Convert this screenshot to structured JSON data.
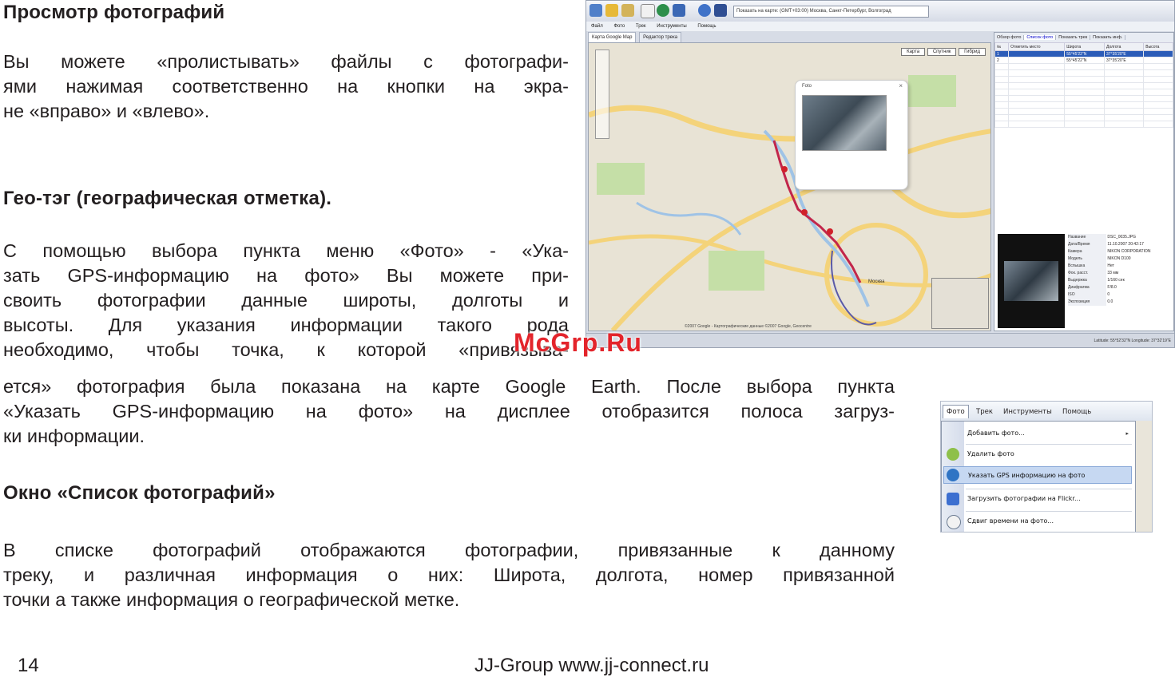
{
  "sections": [
    {
      "heading": "Просмотр фотографий",
      "lines": [
        "Вы можете «пролистывать» файлы с фотографи-",
        "ями нажимая соответственно на кнопки на экра-",
        "не «вправо» и «влево»."
      ]
    },
    {
      "heading": "Гео-тэг (географическая отметка).",
      "lines": [
        "С помощью выбора пункта меню «Фото» - «Ука-",
        "зать GPS-информацию на фото» Вы можете при-",
        "своить фотографии данные широты, долготы и",
        "высоты. Для указания информации такого рода",
        "необходимо, чтобы точка, к которой «привязыва-",
        "ется» фотография была показана на карте Google Earth. После выбора пункта",
        "«Указать GPS-информацию на фото» на дисплее отобразится полоса загруз-",
        "ки информации."
      ]
    },
    {
      "heading": "Окно «Список фотографий»",
      "lines": [
        "В списке фотографий отображаются фотографии, привязанные к данному",
        "треку, и различная информация о них:  Широта, долгота, номер привязанной",
        "точки а также информация о географической метке."
      ]
    }
  ],
  "footer": {
    "page_number": "14",
    "publisher": "JJ-Group www.jj-connect.ru"
  },
  "watermark": "McGrp.Ru",
  "app_screenshot": {
    "location_combo": "Показать на карте: (GMT+03:00) Москва, Санкт-Петербург, Волгоград",
    "menubar": [
      "Файл",
      "Фото",
      "Трек",
      "Инструменты",
      "Помощь"
    ],
    "map_tabs": [
      "Карта Google Map",
      "Редактор трека"
    ],
    "map_buttons": [
      "Карта",
      "Спутник",
      "Гибрид"
    ],
    "popup_title": "Foto",
    "map_city_label": "Москва",
    "map_copyright": "©2007 Google - Картографические данные ©2007 Google, Geocentre",
    "right_tabs": [
      "Обзор фото",
      "Список фото",
      "Показать трек",
      "Показать инф."
    ],
    "table_headers": [
      "№",
      "Отметить место",
      "Широта",
      "Долгота",
      "Высота"
    ],
    "table_rows": [
      [
        "1",
        "",
        "55°45'22\"N",
        "37°35'20\"E",
        ""
      ],
      [
        "2",
        "",
        "55°45'22\"N",
        "37°35'20\"E",
        ""
      ]
    ],
    "properties": [
      [
        "Название",
        "DSC_0035.JPG"
      ],
      [
        "Дата/Время",
        "11.10.2007 20:42:17"
      ],
      [
        "Камера",
        "NIKON CORPORATION"
      ],
      [
        "Модель",
        "NIKON D100"
      ],
      [
        "Вспышка",
        "Нет"
      ],
      [
        "Фок. расст.",
        "33 мм"
      ],
      [
        "Выдержка",
        "1/160 сек"
      ],
      [
        "Диафрагма",
        "F/8.0"
      ],
      [
        "ISO",
        "0"
      ],
      [
        "Экспозиция",
        "0.0"
      ]
    ],
    "status": "Latitude: 55°52'32\"N  Longitude: 37°32'19\"E"
  },
  "menu_screenshot": {
    "menubar": [
      "Фото",
      "Трек",
      "Инструменты",
      "Помощь"
    ],
    "items": [
      "Добавить фото...",
      "Удалить фото",
      "Указать GPS информацию на фото",
      "Загрузить фотографии на Flickr...",
      "Сдвиг времени на фото..."
    ],
    "highlighted_index": 2,
    "colors": {
      "highlight": "#c6d8f2",
      "gutter": "#dfe5ef"
    }
  }
}
